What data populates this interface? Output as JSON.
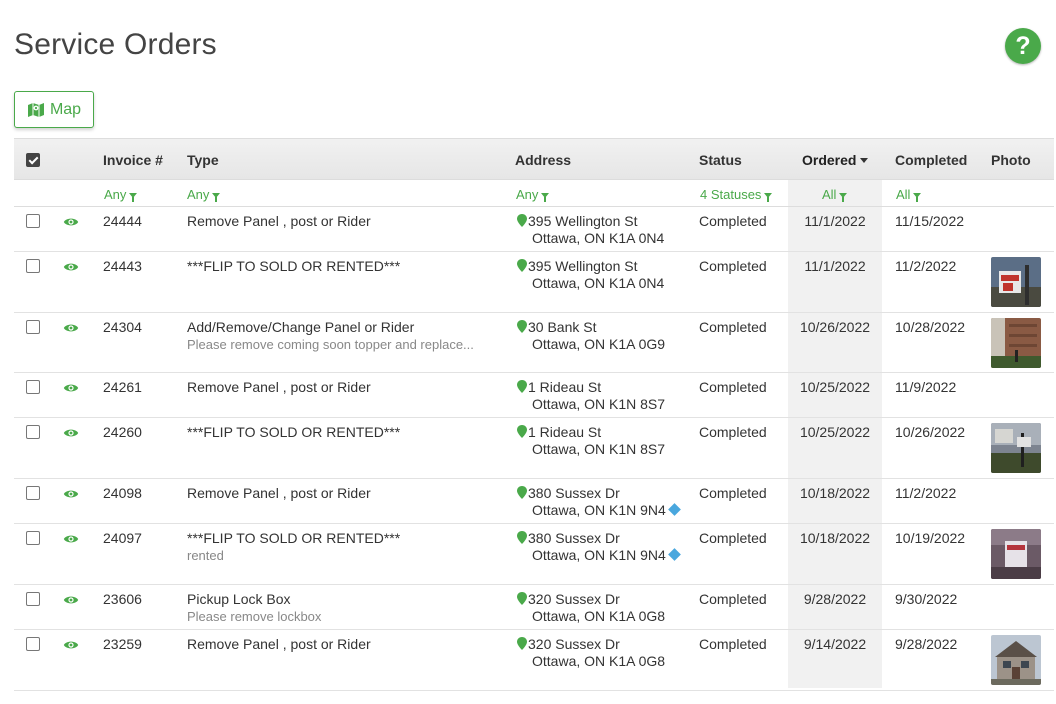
{
  "page": {
    "title": "Service Orders"
  },
  "help": {
    "label": "?"
  },
  "toolbar": {
    "map_label": "Map"
  },
  "colors": {
    "accent": "#4aa94a",
    "link_blue": "#49a7de"
  },
  "table": {
    "headers": {
      "invoice": "Invoice #",
      "type": "Type",
      "address": "Address",
      "status": "Status",
      "ordered": "Ordered",
      "completed": "Completed",
      "photo": "Photo"
    },
    "sort": {
      "column": "Ordered",
      "direction": "descending"
    },
    "filters": {
      "invoice": "Any",
      "type": "Any",
      "address": "Any",
      "status": "4 Statuses",
      "ordered": "All",
      "completed": "All"
    },
    "rows": [
      {
        "invoice": "24444",
        "type": "Remove Panel , post or Rider",
        "note": "",
        "addr1": "395 Wellington St",
        "addr2": "Ottawa, ON K1A 0N4",
        "addr_link": false,
        "status": "Completed",
        "ordered": "11/1/2022",
        "completed": "11/15/2022",
        "photo": ""
      },
      {
        "invoice": "24443",
        "type": "***FLIP TO SOLD OR RENTED***",
        "note": "",
        "addr1": "395 Wellington St",
        "addr2": "Ottawa, ON K1A 0N4",
        "addr_link": false,
        "status": "Completed",
        "ordered": "11/1/2022",
        "completed": "11/2/2022",
        "photo": "sign-photo"
      },
      {
        "invoice": "24304",
        "type": "Add/Remove/Change Panel or Rider",
        "note": "Please remove coming soon topper and replace...",
        "addr1": "30 Bank St",
        "addr2": "Ottawa, ON K1A 0G9",
        "addr_link": false,
        "status": "Completed",
        "ordered": "10/26/2022",
        "completed": "10/28/2022",
        "photo": "brick-photo"
      },
      {
        "invoice": "24261",
        "type": "Remove Panel , post or Rider",
        "note": "",
        "addr1": "1 Rideau St",
        "addr2": "Ottawa, ON K1N 8S7",
        "addr_link": false,
        "status": "Completed",
        "ordered": "10/25/2022",
        "completed": "11/9/2022",
        "photo": ""
      },
      {
        "invoice": "24260",
        "type": "***FLIP TO SOLD OR RENTED***",
        "note": "",
        "addr1": "1 Rideau St",
        "addr2": "Ottawa, ON K1N 8S7",
        "addr_link": false,
        "status": "Completed",
        "ordered": "10/25/2022",
        "completed": "10/26/2022",
        "photo": "yard-photo"
      },
      {
        "invoice": "24098",
        "type": "Remove Panel , post or Rider",
        "note": "",
        "addr1": "380 Sussex Dr",
        "addr2": "Ottawa, ON K1N 9N4",
        "addr_link": true,
        "status": "Completed",
        "ordered": "10/18/2022",
        "completed": "11/2/2022",
        "photo": ""
      },
      {
        "invoice": "24097",
        "type": "***FLIP TO SOLD OR RENTED***",
        "note": "rented",
        "addr1": "380 Sussex Dr",
        "addr2": "Ottawa, ON K1N 9N4",
        "addr_link": true,
        "status": "Completed",
        "ordered": "10/18/2022",
        "completed": "10/19/2022",
        "photo": "rider-photo"
      },
      {
        "invoice": "23606",
        "type": "Pickup Lock Box",
        "note": "Please remove lockbox",
        "addr1": "320 Sussex Dr",
        "addr2": "Ottawa, ON K1A 0G8",
        "addr_link": false,
        "status": "Completed",
        "ordered": "9/28/2022",
        "completed": "9/30/2022",
        "photo": ""
      },
      {
        "invoice": "23259",
        "type": "Remove Panel , post or Rider",
        "note": "",
        "addr1": "320 Sussex Dr",
        "addr2": "Ottawa, ON K1A 0G8",
        "addr_link": false,
        "status": "Completed",
        "ordered": "9/14/2022",
        "completed": "9/28/2022",
        "photo": "house-photo"
      }
    ]
  }
}
